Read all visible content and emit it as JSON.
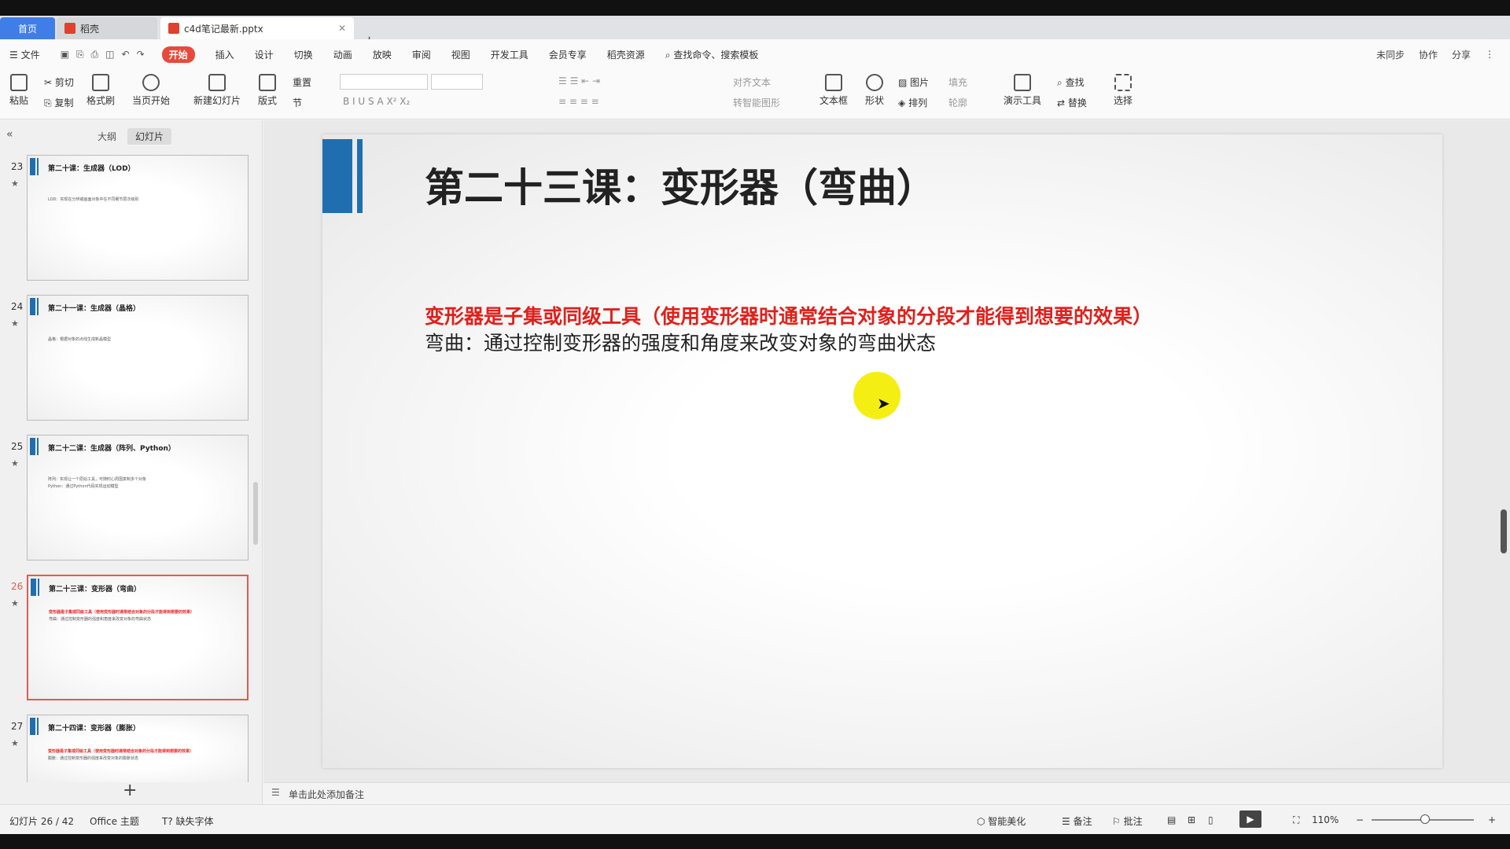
{
  "tabs": {
    "home": "首页",
    "daoke": "稻壳",
    "file": "c4d笔记最新.pptx"
  },
  "menu": {
    "file": "文件",
    "items": [
      "开始",
      "插入",
      "设计",
      "切换",
      "动画",
      "放映",
      "审阅",
      "视图",
      "开发工具",
      "会员专享",
      "稻壳资源"
    ],
    "search": "查找命令、搜索模板",
    "right": [
      "未同步",
      "协作",
      "分享"
    ]
  },
  "ribbon": {
    "paste": "粘贴",
    "cut": "剪切",
    "copy": "复制",
    "format_painter": "格式刷",
    "start_current": "当页开始",
    "new_slide": "新建幻灯片",
    "layout": "版式",
    "reset": "重置",
    "section": "节",
    "align_text": "对齐文本",
    "smart_graphic": "转智能图形",
    "textbox": "文本框",
    "shape": "形状",
    "picture": "图片",
    "arrange": "排列",
    "fill": "填充",
    "outline": "轮廓",
    "present_tools": "演示工具",
    "find": "查找",
    "replace": "替换",
    "select": "选择"
  },
  "leftpane": {
    "outline": "大纲",
    "slides": "幻灯片",
    "add": "+"
  },
  "thumbs": [
    {
      "num": "23",
      "title": "第二十课：生成器（LOD）",
      "lines": [
        "LOD：实现在分辨或画面对象中在不同细节层次级别"
      ],
      "red": false
    },
    {
      "num": "24",
      "title": "第二十一课：生成器（晶格）",
      "lines": [
        "晶格：根据对象的点线生成新晶模型"
      ],
      "red": false
    },
    {
      "num": "25",
      "title": "第二十二课：生成器（阵列、Python）",
      "lines": [
        "阵列：实现让一个原始工具，可随时心周围复制多个对象",
        "Python：通过Python代码实现运动模型"
      ],
      "red": false
    },
    {
      "num": "26",
      "title": "第二十三课：变形器（弯曲）",
      "lines": [
        "变形器是子集或同级工具（使用变形器时通常结合对象的分段才能得到想要的效果）",
        "弯曲：通过控制变形器的强度和角度来改变对象的弯曲状态"
      ],
      "red": true
    },
    {
      "num": "27",
      "title": "第二十四课：变形器（膨胀）",
      "lines": [
        "变形器是子集或同级工具（使用变形器时通常结合对象的分段才能得到想要的效果）",
        "膨胀：通过控制变形器的强度来改变对象的膨胀状态"
      ],
      "red": true
    }
  ],
  "slide": {
    "title": "第二十三课：变形器（弯曲）",
    "red_line": "变形器是子集或同级工具（使用变形器时通常结合对象的分段才能得到想要的效果）",
    "black_line": "弯曲：通过控制变形器的强度和角度来改变对象的弯曲状态"
  },
  "notes": {
    "placeholder": "单击此处添加备注"
  },
  "status": {
    "slide_count": "幻灯片 26 / 42",
    "theme": "Office 主题",
    "missing_font": "缺失字体",
    "beautify": "智能美化",
    "notes": "备注",
    "comments": "批注",
    "zoom": "110%"
  },
  "colors": {
    "accent_red": "#e0201b",
    "slide_bar": "#1f6fb0",
    "tab_home": "#3f7ee8"
  }
}
